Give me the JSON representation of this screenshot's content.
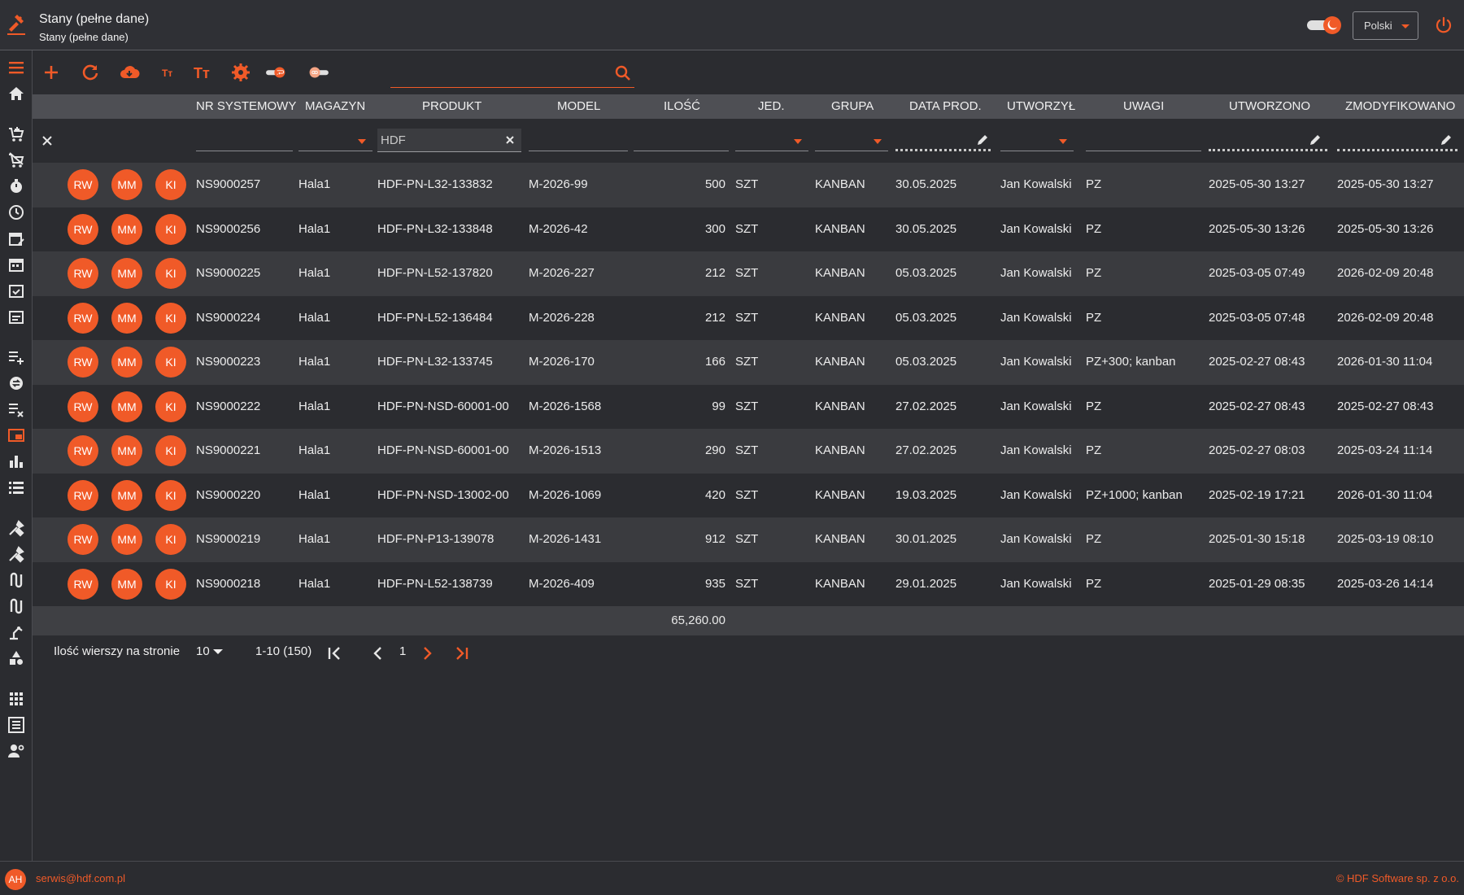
{
  "app": {
    "title": "Stany (pełne dane)",
    "subtitle": "Stany (pełne dane)",
    "language": "Polski",
    "accent_color": "#f05a28"
  },
  "sidebar": {
    "items": [
      {
        "icon": "menu-icon"
      },
      {
        "icon": "home-icon"
      },
      {
        "icon": "cart-add-icon"
      },
      {
        "icon": "cart-remove-icon"
      },
      {
        "icon": "stopwatch-icon"
      },
      {
        "icon": "clock-icon"
      },
      {
        "icon": "calendar-edit-icon"
      },
      {
        "icon": "calendar-icon"
      },
      {
        "icon": "calendar-check-icon"
      },
      {
        "icon": "calendar-note-icon"
      },
      {
        "icon": "playlist-add-icon"
      },
      {
        "icon": "currency-exchange-icon"
      },
      {
        "icon": "playlist-remove-icon"
      },
      {
        "icon": "picture-in-picture-icon"
      },
      {
        "icon": "bar-chart-icon"
      },
      {
        "icon": "list-icon"
      },
      {
        "icon": "tools-icon"
      },
      {
        "icon": "tools-alt-icon"
      },
      {
        "icon": "transfer-icon"
      },
      {
        "icon": "transfer-alt-icon"
      },
      {
        "icon": "robot-arm-icon"
      },
      {
        "icon": "shapes-icon"
      },
      {
        "icon": "apps-grid-icon"
      },
      {
        "icon": "list-box-icon"
      },
      {
        "icon": "users-settings-icon"
      }
    ]
  },
  "toolbar": {
    "search_value": ""
  },
  "table": {
    "columns": [
      "NR SYSTEMOWY",
      "MAGAZYN",
      "PRODUKT",
      "MODEL",
      "ILOŚĆ",
      "JED.",
      "GRUPA",
      "DATA PROD.",
      "UTWORZYŁ",
      "UWAGI",
      "UTWORZONO",
      "ZMODYFIKOWANO"
    ],
    "filters": {
      "produkt": "HDF"
    },
    "action_labels": [
      "RW",
      "MM",
      "KI"
    ],
    "rows": [
      [
        "NS9000257",
        "Hala1",
        "HDF-PN-L32-133832",
        "M-2026-99",
        "500",
        "SZT",
        "KANBAN",
        "30.05.2025",
        "Jan Kowalski",
        "PZ",
        "2025-05-30 13:27",
        "2025-05-30 13:27"
      ],
      [
        "NS9000256",
        "Hala1",
        "HDF-PN-L32-133848",
        "M-2026-42",
        "300",
        "SZT",
        "KANBAN",
        "30.05.2025",
        "Jan Kowalski",
        "PZ",
        "2025-05-30 13:26",
        "2025-05-30 13:26"
      ],
      [
        "NS9000225",
        "Hala1",
        "HDF-PN-L52-137820",
        "M-2026-227",
        "212",
        "SZT",
        "KANBAN",
        "05.03.2025",
        "Jan Kowalski",
        "PZ",
        "2025-03-05 07:49",
        "2026-02-09 20:48"
      ],
      [
        "NS9000224",
        "Hala1",
        "HDF-PN-L52-136484",
        "M-2026-228",
        "212",
        "SZT",
        "KANBAN",
        "05.03.2025",
        "Jan Kowalski",
        "PZ",
        "2025-03-05 07:48",
        "2026-02-09 20:48"
      ],
      [
        "NS9000223",
        "Hala1",
        "HDF-PN-L32-133745",
        "M-2026-170",
        "166",
        "SZT",
        "KANBAN",
        "05.03.2025",
        "Jan Kowalski",
        "PZ+300; kanban",
        "2025-02-27 08:43",
        "2026-01-30 11:04"
      ],
      [
        "NS9000222",
        "Hala1",
        "HDF-PN-NSD-60001-00",
        "M-2026-1568",
        "99",
        "SZT",
        "KANBAN",
        "27.02.2025",
        "Jan Kowalski",
        "PZ",
        "2025-02-27 08:43",
        "2025-02-27 08:43"
      ],
      [
        "NS9000221",
        "Hala1",
        "HDF-PN-NSD-60001-00",
        "M-2026-1513",
        "290",
        "SZT",
        "KANBAN",
        "27.02.2025",
        "Jan Kowalski",
        "PZ",
        "2025-02-27 08:03",
        "2025-03-24 11:14"
      ],
      [
        "NS9000220",
        "Hala1",
        "HDF-PN-NSD-13002-00",
        "M-2026-1069",
        "420",
        "SZT",
        "KANBAN",
        "19.03.2025",
        "Jan Kowalski",
        "PZ+1000; kanban",
        "2025-02-19 17:21",
        "2026-01-30 11:04"
      ],
      [
        "NS9000219",
        "Hala1",
        "HDF-PN-P13-139078",
        "M-2026-1431",
        "912",
        "SZT",
        "KANBAN",
        "30.01.2025",
        "Jan Kowalski",
        "PZ",
        "2025-01-30 15:18",
        "2025-03-19 08:10"
      ],
      [
        "NS9000218",
        "Hala1",
        "HDF-PN-L52-138739",
        "M-2026-409",
        "935",
        "SZT",
        "KANBAN",
        "29.01.2025",
        "Jan Kowalski",
        "PZ",
        "2025-01-29 08:35",
        "2025-03-26 14:14"
      ]
    ],
    "sum": "65,260.00"
  },
  "pagination": {
    "rows_label": "Ilość wierszy na stronie",
    "rows_per_page": "10",
    "range": "1-10 (150)",
    "current_page": "1"
  },
  "footer": {
    "avatar_initials": "AH",
    "email": "serwis@hdf.com.pl",
    "copyright": "© HDF Software sp. z o.o."
  }
}
